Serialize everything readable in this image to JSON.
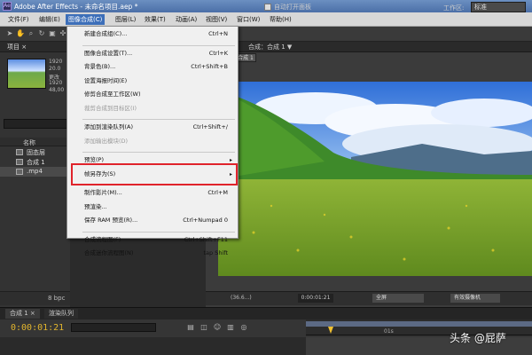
{
  "app": {
    "title": "Adobe After Effects - 未命名项目.aep *",
    "icon_name": "after-effects-icon",
    "icon_text": "Ae"
  },
  "menubar": {
    "items": [
      "文件(F)",
      "编辑(E)",
      "图像合成(C)",
      "图层(L)",
      "效果(T)",
      "动画(A)",
      "视图(V)",
      "窗口(W)",
      "帮助(H)"
    ],
    "active_index": 2
  },
  "toolbar": {
    "auto_open_label": "自动打开面板",
    "workspace_label": "工作区:",
    "workspace_value": "标准",
    "auto_open_checked": true
  },
  "project_panel": {
    "tab_label": "项目 ×",
    "meta": [
      "1920",
      "20.0",
      "更改",
      "1920",
      "48,00"
    ],
    "column_header": "名称",
    "rows": [
      {
        "label": "固态层",
        "icon": "folder-icon"
      },
      {
        "label": "合成 1",
        "icon": "composition-icon"
      },
      {
        "label": ".mp4",
        "icon": "video-file-icon"
      }
    ],
    "bpc": "8 bpc"
  },
  "viewer": {
    "tab_label": "合成：合成 1 ▼",
    "comp_chip": "合成 1",
    "zoom": "(36.6...)",
    "time": "0:00:01:21",
    "quality": "全屏",
    "view": "有效摄像机"
  },
  "dropdown": {
    "items": [
      {
        "label": "新建合成组(C)...",
        "shortcut": "Ctrl+N",
        "enabled": true
      },
      {
        "sep": true
      },
      {
        "label": "图像合成设置(T)...",
        "shortcut": "Ctrl+K",
        "enabled": true
      },
      {
        "label": "背景色(B)...",
        "shortcut": "Ctrl+Shift+B",
        "enabled": true
      },
      {
        "label": "设置海报时间(E)",
        "shortcut": "",
        "enabled": true
      },
      {
        "label": "修剪合成至工作区(W)",
        "shortcut": "",
        "enabled": true
      },
      {
        "label": "裁剪合成到目标区(I)",
        "shortcut": "",
        "enabled": false
      },
      {
        "sep": true
      },
      {
        "label": "添加到渲染队列(A)",
        "shortcut": "Ctrl+Shift+/",
        "enabled": true
      },
      {
        "label": "添加输出模块(D)",
        "shortcut": "",
        "enabled": false
      },
      {
        "sep": true
      },
      {
        "label": "预览(P)",
        "shortcut": "",
        "enabled": true,
        "submenu": true
      },
      {
        "label": "帧另存为(S)",
        "shortcut": "",
        "enabled": true,
        "submenu": true
      },
      {
        "sep": true
      },
      {
        "label": "制作影片(M)...",
        "shortcut": "Ctrl+M",
        "enabled": true,
        "highlighted": true
      },
      {
        "label": "预渲染...",
        "shortcut": "",
        "enabled": true
      },
      {
        "label": "保存 RAM 预览(R)...",
        "shortcut": "Ctrl+Numpad 0",
        "enabled": true
      },
      {
        "sep": true
      },
      {
        "label": "合成流程图(F)",
        "shortcut": "Ctrl+Shift+F11",
        "enabled": true
      },
      {
        "label": "合成迷你流程图(N)",
        "shortcut": "tap Shift",
        "enabled": true
      }
    ]
  },
  "timeline": {
    "tabs": [
      "合成 1 ×",
      "渲染队列"
    ],
    "timecode": "0:00:01:21",
    "ruler_mark": "01s"
  },
  "watermark": "头条 @屁萨",
  "colors": {
    "highlight_border": "#e0232b",
    "menu_active": "#3d6fb9",
    "timecode": "#e2b52d"
  }
}
